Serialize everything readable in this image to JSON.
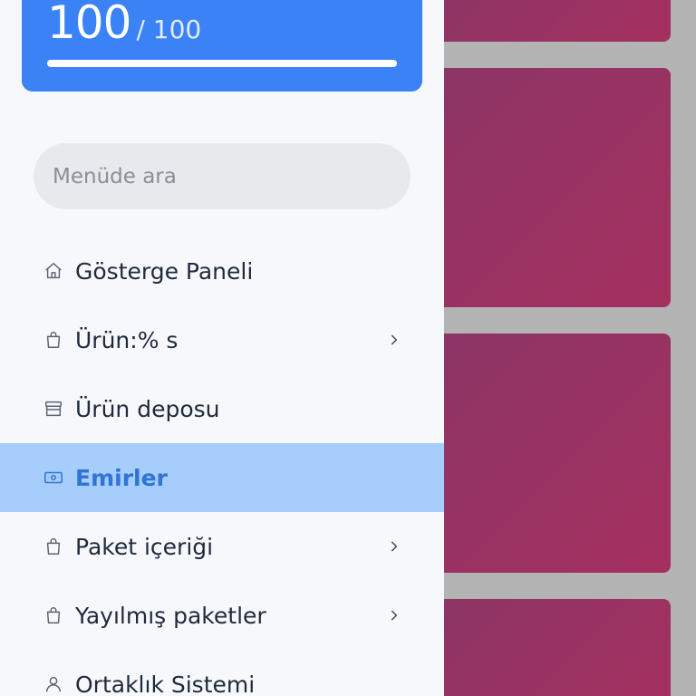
{
  "score": {
    "value": "100",
    "max": "/ 100",
    "progress_percent": 100
  },
  "search": {
    "placeholder": "Menüde ara"
  },
  "menu": {
    "items": [
      {
        "label": "Gösterge Paneli",
        "icon": "home-icon",
        "has_submenu": false,
        "active": false
      },
      {
        "label": "Ürün:% s",
        "icon": "shopping-bag-icon",
        "has_submenu": true,
        "active": false
      },
      {
        "label": "Ürün deposu",
        "icon": "store-icon",
        "has_submenu": false,
        "active": false
      },
      {
        "label": "Emirler",
        "icon": "money-icon",
        "has_submenu": false,
        "active": true
      },
      {
        "label": "Paket içeriği",
        "icon": "shopping-bag-icon",
        "has_submenu": true,
        "active": false
      },
      {
        "label": "Yayılmış paketler",
        "icon": "shopping-bag-icon",
        "has_submenu": true,
        "active": false
      },
      {
        "label": "Ortaklık Sistemi",
        "icon": "user-icon",
        "has_submenu": false,
        "active": false
      }
    ]
  },
  "colors": {
    "accent": "#3b82f6",
    "active_bg": "#a6cdfb",
    "active_text": "#2f74d6",
    "card_gradient_start": "#8b3566",
    "card_gradient_end": "#a5305f"
  }
}
